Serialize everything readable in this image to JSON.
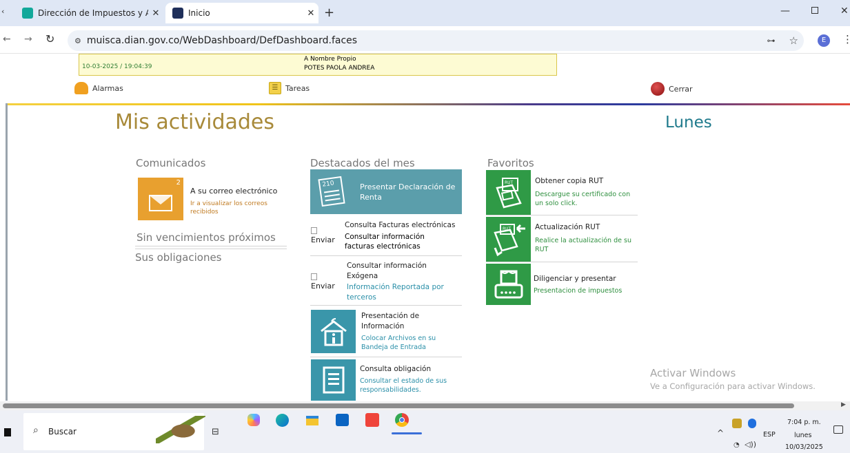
{
  "browser": {
    "tabs": [
      {
        "title": "Dirección de Impuestos y Adua",
        "active": false
      },
      {
        "title": "Inicio",
        "active": true
      }
    ],
    "new_tab": "+",
    "url": "muisca.dian.gov.co/WebDashboard/DefDashboard.faces",
    "profile_initial": "E"
  },
  "header": {
    "datetime": "10-03-2025 / 19:04:39",
    "name_label": "A Nombre Propio",
    "name_value": "POTES PAOLA ANDREA"
  },
  "menu": {
    "alarmas": "Alarmas",
    "tareas": "Tareas",
    "cerrar": "Cerrar"
  },
  "page": {
    "title": "Mis actividades",
    "day": "Lunes"
  },
  "comunicados": {
    "title": "Comunicados",
    "count": "2",
    "item_title": "A su correo electrónico",
    "item_desc": "Ir a visualizar los correos recibidos",
    "sin_vencimientos": "Sin vencimientos próximos",
    "obligaciones": "Sus obligaciones"
  },
  "destacados": {
    "title": "Destacados del mes",
    "renta_label": "Presentar Declaración de Renta",
    "renta_number": "210",
    "items": [
      {
        "alt": "Enviar",
        "title": "Consulta Facturas electrónicas",
        "desc": "Consultar información facturas electrónicas"
      },
      {
        "alt": "Enviar",
        "title": "Consultar información Exógena",
        "desc": "Información Reportada por terceros"
      },
      {
        "title": "Presentación de Información",
        "desc": "Colocar Archivos en su Bandeja de Entrada"
      },
      {
        "title": "Consulta obligación",
        "desc": "Consultar el estado de sus responsabilidades."
      }
    ]
  },
  "favoritos": {
    "title": "Favoritos",
    "items": [
      {
        "title": "Obtener copia RUT",
        "desc": "Descargue su certificado con un solo click.",
        "badge": "RUT"
      },
      {
        "title": "Actualización RUT",
        "desc": "Realice la actualización de su RUT",
        "badge": "RUT"
      },
      {
        "title": "Diligenciar y presentar",
        "desc": "Presentacion de impuestos"
      }
    ]
  },
  "watermark": {
    "line1": "Activar Windows",
    "line2": "Ve a Configuración para activar Windows."
  },
  "taskbar": {
    "search_placeholder": "Buscar",
    "lang": "ESP",
    "time": "7:04 p. m.",
    "weekday": "lunes",
    "date": "10/03/2025"
  },
  "colors": {
    "green": "#2e8f3e",
    "teal": "#5b9eab",
    "orange": "#e8a02f",
    "gold_title": "#a88a3a",
    "day_teal": "#1f7a8c"
  }
}
